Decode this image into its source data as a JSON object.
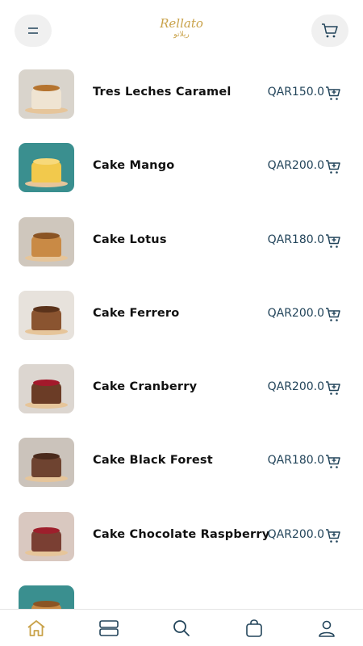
{
  "app": {
    "logo_text": "Rellato",
    "logo_sub": "ريلاتو"
  },
  "products": [
    {
      "name": "Tres Leches Caramel",
      "price": "QAR150.0",
      "bg": "#d9d4cc",
      "cake": "#efe4d2",
      "top": "#b5742f"
    },
    {
      "name": "Cake Mango",
      "price": "QAR200.0",
      "bg": "#3a8f8f",
      "cake": "#f2c94c",
      "top": "#f7d97a"
    },
    {
      "name": "Cake Lotus",
      "price": "QAR180.0",
      "bg": "#cfc7bd",
      "cake": "#c98a45",
      "top": "#8a5424"
    },
    {
      "name": "Cake Ferrero",
      "price": "QAR200.0",
      "bg": "#e7e2dc",
      "cake": "#8a5430",
      "top": "#5b331b"
    },
    {
      "name": "Cake Cranberry",
      "price": "QAR200.0",
      "bg": "#dcd6d0",
      "cake": "#6b3c26",
      "top": "#a3192b"
    },
    {
      "name": "Cake Black Forest",
      "price": "QAR180.0",
      "bg": "#cbc3bb",
      "cake": "#6e4330",
      "top": "#4a2a1c"
    },
    {
      "name": "Cake Chocolate Raspberry",
      "price": "QAR200.0",
      "bg": "#d9c8c0",
      "cake": "#7a3f33",
      "top": "#9e1f2c"
    },
    {
      "name": "",
      "price": "",
      "bg": "#3a8f8f",
      "cake": "#c98a45",
      "top": "#8a5424"
    }
  ],
  "colors": {
    "accent": "#c9a24a",
    "price": "#22445a",
    "icon": "#22445a",
    "nav_active": "#c9a24a"
  },
  "bottom_nav": [
    {
      "id": "home",
      "icon": "home-icon",
      "active": true
    },
    {
      "id": "categories",
      "icon": "categories-icon",
      "active": false
    },
    {
      "id": "search",
      "icon": "search-icon",
      "active": false
    },
    {
      "id": "bag",
      "icon": "bag-icon",
      "active": false
    },
    {
      "id": "profile",
      "icon": "profile-icon",
      "active": false
    }
  ]
}
